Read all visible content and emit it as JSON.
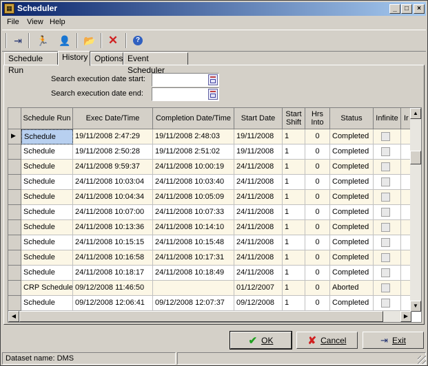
{
  "window": {
    "title": "Scheduler",
    "app_icon": "calendar-icon"
  },
  "menu": [
    "File",
    "View",
    "Help"
  ],
  "toolbar": [
    {
      "icon": "exit-door-icon",
      "glyph": "⇥"
    },
    {
      "icon": "run-person-icon",
      "glyph": "🏃"
    },
    {
      "icon": "schedule-person-icon",
      "glyph": "👤"
    },
    {
      "icon": "open-folder-icon",
      "glyph": "📂"
    },
    {
      "icon": "delete-x-icon",
      "glyph": "✕"
    },
    {
      "icon": "help-icon",
      "glyph": "?"
    }
  ],
  "tabs": [
    {
      "label": "Schedule Run",
      "active": false
    },
    {
      "label": "History",
      "active": true
    },
    {
      "label": "Options",
      "active": false
    },
    {
      "label": "Event Scheduler",
      "active": false
    }
  ],
  "search": {
    "start_label": "Search execution date start:",
    "start_value": "",
    "end_label": "Search execution date end:",
    "end_value": ""
  },
  "grid": {
    "columns": [
      "Schedule Run",
      "Exec Date/Time",
      "Completion Date/Time",
      "Start Date",
      "Start\nShift",
      "Hrs\nInto",
      "Status",
      "Infinite",
      "Ir"
    ],
    "rows": [
      [
        "Schedule",
        "19/11/2008 2:47:29",
        "19/11/2008 2:48:03",
        "19/11/2008",
        "1",
        "0",
        "Completed"
      ],
      [
        "Schedule",
        "19/11/2008 2:50:28",
        "19/11/2008 2:51:02",
        "19/11/2008",
        "1",
        "0",
        "Completed"
      ],
      [
        "Schedule",
        "24/11/2008 9:59:37",
        "24/11/2008 10:00:19",
        "24/11/2008",
        "1",
        "0",
        "Completed"
      ],
      [
        "Schedule",
        "24/11/2008 10:03:04",
        "24/11/2008 10:03:40",
        "24/11/2008",
        "1",
        "0",
        "Completed"
      ],
      [
        "Schedule",
        "24/11/2008 10:04:34",
        "24/11/2008 10:05:09",
        "24/11/2008",
        "1",
        "0",
        "Completed"
      ],
      [
        "Schedule",
        "24/11/2008 10:07:00",
        "24/11/2008 10:07:33",
        "24/11/2008",
        "1",
        "0",
        "Completed"
      ],
      [
        "Schedule",
        "24/11/2008 10:13:36",
        "24/11/2008 10:14:10",
        "24/11/2008",
        "1",
        "0",
        "Completed"
      ],
      [
        "Schedule",
        "24/11/2008 10:15:15",
        "24/11/2008 10:15:48",
        "24/11/2008",
        "1",
        "0",
        "Completed"
      ],
      [
        "Schedule",
        "24/11/2008 10:16:58",
        "24/11/2008 10:17:31",
        "24/11/2008",
        "1",
        "0",
        "Completed"
      ],
      [
        "Schedule",
        "24/11/2008 10:18:17",
        "24/11/2008 10:18:49",
        "24/11/2008",
        "1",
        "0",
        "Completed"
      ],
      [
        "CRP Schedule",
        "09/12/2008 11:46:50",
        "",
        "01/12/2007",
        "1",
        "0",
        "Aborted"
      ],
      [
        "Schedule",
        "09/12/2008 12:06:41",
        "09/12/2008 12:07:37",
        "09/12/2008",
        "1",
        "0",
        "Completed"
      ]
    ]
  },
  "buttons": {
    "ok": "OK",
    "cancel": "Cancel",
    "exit": "Exit"
  },
  "status": {
    "dataset": "Dataset name:  DMS"
  },
  "colors": {
    "title_start": "#0a246a",
    "title_end": "#a6caf0",
    "ok_icon": "#20a020",
    "cancel_icon": "#d02020"
  }
}
